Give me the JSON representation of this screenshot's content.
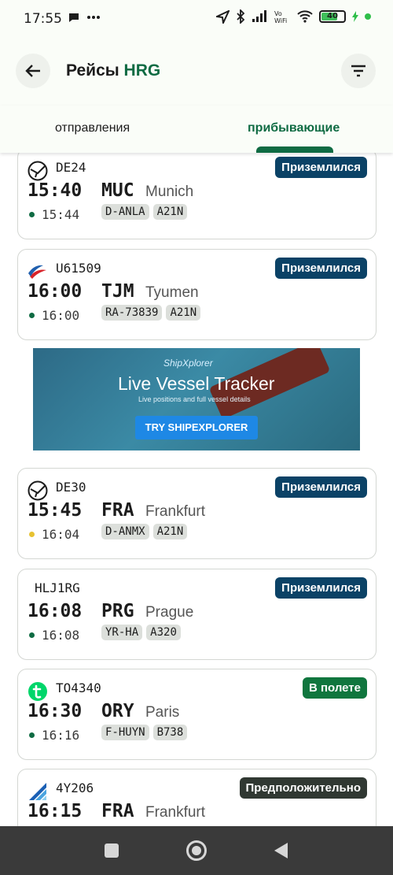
{
  "status_bar": {
    "time": "17:55",
    "battery": "40",
    "icons": [
      "chat-icon",
      "more-icon",
      "location-icon",
      "bluetooth-icon",
      "signal-icon",
      "vowifi-icon",
      "wifi-icon",
      "battery-icon",
      "charging-icon"
    ]
  },
  "appbar": {
    "title_prefix": "Рейсы",
    "title_code": "HRG"
  },
  "tabs": [
    {
      "label": "отправления",
      "selected": false
    },
    {
      "label": "прибывающие",
      "selected": true
    }
  ],
  "flights": [
    {
      "flight": "DE24",
      "scheduled": "15:40",
      "iata": "MUC",
      "city": "Munich",
      "actual": "15:44",
      "actual_dot": "green",
      "registration": "D-ANLA",
      "aircraft": "A21N",
      "status": "Приземлился",
      "status_type": "landed",
      "logo": "condor-logo-icon"
    },
    {
      "flight": "U61509",
      "scheduled": "16:00",
      "iata": "TJM",
      "city": "Tyumen",
      "actual": "16:00",
      "actual_dot": "green",
      "registration": "RA-73839",
      "aircraft": "A21N",
      "status": "Приземлился",
      "status_type": "landed",
      "logo": "ural-airlines-logo-icon"
    },
    {
      "flight": "DE30",
      "scheduled": "15:45",
      "iata": "FRA",
      "city": "Frankfurt",
      "actual": "16:04",
      "actual_dot": "yellow",
      "registration": "D-ANMX",
      "aircraft": "A21N",
      "status": "Приземлился",
      "status_type": "landed",
      "logo": "condor-logo-icon"
    },
    {
      "flight": "HLJ1RG",
      "scheduled": "16:08",
      "iata": "PRG",
      "city": "Prague",
      "actual": "16:08",
      "actual_dot": "green",
      "registration": "YR-HA",
      "aircraft": "A320",
      "status": "Приземлился",
      "status_type": "landed",
      "logo": ""
    },
    {
      "flight": "TO4340",
      "scheduled": "16:30",
      "iata": "ORY",
      "city": "Paris",
      "actual": "16:16",
      "actual_dot": "green",
      "registration": "F-HUYN",
      "aircraft": "B738",
      "status": "В полете",
      "status_type": "airborne",
      "logo": "transavia-logo-icon"
    },
    {
      "flight": "4Y206",
      "scheduled": "16:15",
      "iata": "FRA",
      "city": "Frankfurt",
      "actual": "",
      "actual_dot": "",
      "registration": "",
      "aircraft": "",
      "status": "Предположительно",
      "status_type": "estimated",
      "logo": "discover-logo-icon"
    }
  ],
  "ad": {
    "brand": "ShipXplorer",
    "headline": "Live Vessel Tracker",
    "sub": "Live positions and full vessel details",
    "cta": "TRY SHIPEXPLORER"
  },
  "colors": {
    "accent": "#0f6b43",
    "landed": "#0b4266",
    "airborne": "#10763e",
    "estimated": "#303832",
    "delayed_dot": "#e7c232"
  }
}
